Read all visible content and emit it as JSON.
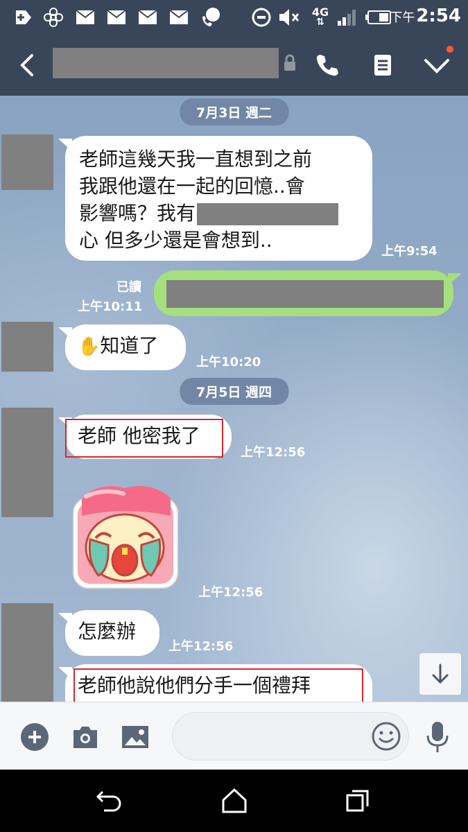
{
  "status_bar": {
    "time_prefix": "下午",
    "time": "2:54",
    "network": "4G"
  },
  "header": {
    "contact_name_redacted": true
  },
  "messages": {
    "date1": "7月3日 週二",
    "m1_lines": [
      "老師這幾天我一直想到之前",
      "我跟他還在一起的回憶..會",
      "影響嗎？我有",
      "心 但多少還是會想到.."
    ],
    "m1_time": "上午9:54",
    "read_label": "已讀",
    "m2_time": "上午10:11",
    "m3_text": "知道了",
    "m3_time": "上午10:20",
    "date2": "7月5日 週四",
    "m4_text": "老師 他密我了",
    "m4_time": "上午12:56",
    "m5_time": "上午12:56",
    "m6_text": "怎麼辦",
    "m6_time": "上午12:56",
    "m7_text": "老師他說他們分手一個禮拜"
  },
  "colors": {
    "header": "#39465a",
    "bubble_green": "#a5df7e",
    "highlight_red": "#d8262b"
  }
}
